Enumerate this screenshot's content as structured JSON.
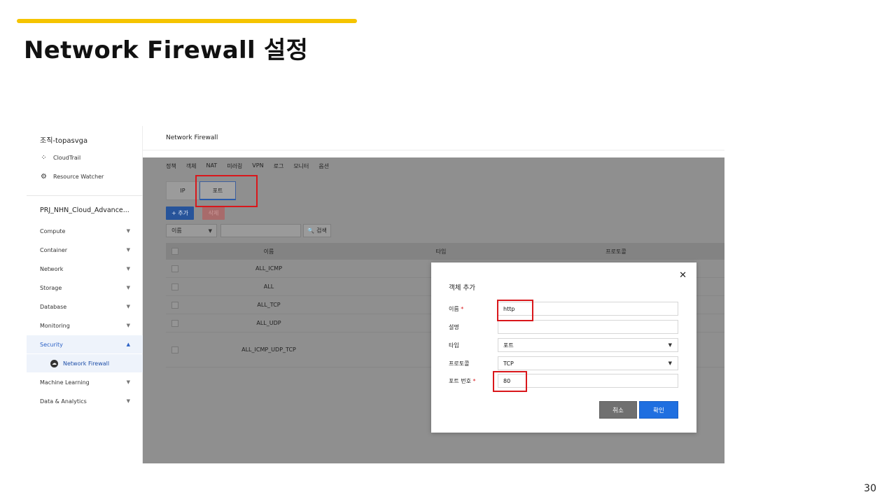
{
  "slide": {
    "title": "Network Firewall 설정",
    "page_number": "30"
  },
  "sidebar": {
    "org": "조직-topasvga",
    "links": [
      {
        "label": "CloudTrail",
        "icon": "cloudtrail-icon"
      },
      {
        "label": "Resource Watcher",
        "icon": "resource-watcher-icon"
      }
    ],
    "project": "PRJ_NHN_Cloud_Advance...",
    "menu": [
      {
        "label": "Compute"
      },
      {
        "label": "Container"
      },
      {
        "label": "Network"
      },
      {
        "label": "Storage"
      },
      {
        "label": "Database"
      },
      {
        "label": "Monitoring"
      },
      {
        "label": "Security",
        "active": true
      },
      {
        "label": "Machine Learning"
      },
      {
        "label": "Data & Analytics"
      }
    ],
    "sub_item": "Network Firewall"
  },
  "content": {
    "title": "Network Firewall",
    "tabs": [
      "정책",
      "객체",
      "NAT",
      "미러링",
      "VPN",
      "로그",
      "모니터",
      "옵션"
    ],
    "segments": {
      "ip": "IP",
      "port": "포트"
    },
    "add_button": "+ 추가",
    "delete_button": "삭제",
    "filter_select": "이름",
    "search_button": "검색",
    "grid_headers": [
      "이름",
      "타입",
      "프로토콜"
    ],
    "rows": [
      "ALL_ICMP",
      "ALL",
      "ALL_TCP",
      "ALL_UDP",
      "ALL_ICMP_UDP_TCP"
    ]
  },
  "modal": {
    "title": "객체 추가",
    "fields": {
      "name_label": "이름",
      "name_value": "http",
      "desc_label": "설명",
      "desc_value": "",
      "type_label": "타입",
      "type_value": "포트",
      "protocol_label": "프로토콜",
      "protocol_value": "TCP",
      "port_label": "포트 번호",
      "port_value": "80"
    },
    "cancel": "취소",
    "confirm": "확인"
  },
  "colors": {
    "accent": "#f5c400",
    "highlight": "#d9171b",
    "primary": "#1f6fe0"
  }
}
